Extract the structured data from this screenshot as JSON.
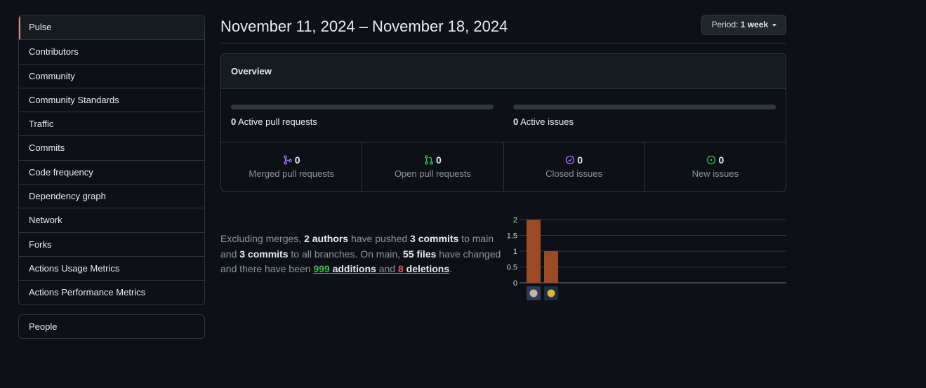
{
  "sidebar": {
    "items": [
      {
        "label": "Pulse",
        "selected": true
      },
      {
        "label": "Contributors"
      },
      {
        "label": "Community"
      },
      {
        "label": "Community Standards"
      },
      {
        "label": "Traffic"
      },
      {
        "label": "Commits"
      },
      {
        "label": "Code frequency"
      },
      {
        "label": "Dependency graph"
      },
      {
        "label": "Network"
      },
      {
        "label": "Forks"
      },
      {
        "label": "Actions Usage Metrics"
      },
      {
        "label": "Actions Performance Metrics"
      }
    ],
    "secondary": [
      {
        "label": "People"
      }
    ]
  },
  "header": {
    "date_range": "November 11, 2024 – November 18, 2024",
    "period_label": "Period:",
    "period_value": "1 week"
  },
  "overview": {
    "title": "Overview",
    "active_prs": {
      "count": "0",
      "label": "Active pull requests",
      "fill": 0
    },
    "active_issues": {
      "count": "0",
      "label": "Active issues",
      "fill": 0
    },
    "stats": [
      {
        "count": "0",
        "label": "Merged pull requests",
        "icon": "git-merge-icon",
        "color": "#a371f7"
      },
      {
        "count": "0",
        "label": "Open pull requests",
        "icon": "git-pull-request-icon",
        "color": "#3fb950"
      },
      {
        "count": "0",
        "label": "Closed issues",
        "icon": "issue-closed-icon",
        "color": "#a371f7"
      },
      {
        "count": "0",
        "label": "New issues",
        "icon": "issue-opened-icon",
        "color": "#3fb950"
      }
    ]
  },
  "summary": {
    "t1": "Excluding merges, ",
    "authors": "2 authors",
    "t2": " have pushed ",
    "commits_main": "3 commits",
    "t3": " to main and ",
    "commits_all": "3 commits",
    "t4": " to all branches. On main, ",
    "files": "55 files",
    "t5": " have changed and there have been ",
    "additions_num": "999",
    "additions_word": "additions",
    "t6": " and ",
    "deletions_num": "8",
    "deletions_word": "deletions",
    "t7": "."
  },
  "chart_data": {
    "type": "bar",
    "categories": [
      "contributor-1",
      "contributor-2"
    ],
    "values": [
      2,
      1
    ],
    "ylim": [
      0,
      2
    ],
    "yticks": [
      "0",
      "0.5",
      "1",
      "1.5",
      "2"
    ],
    "bar_color": "#9a4a24",
    "grid": true
  }
}
